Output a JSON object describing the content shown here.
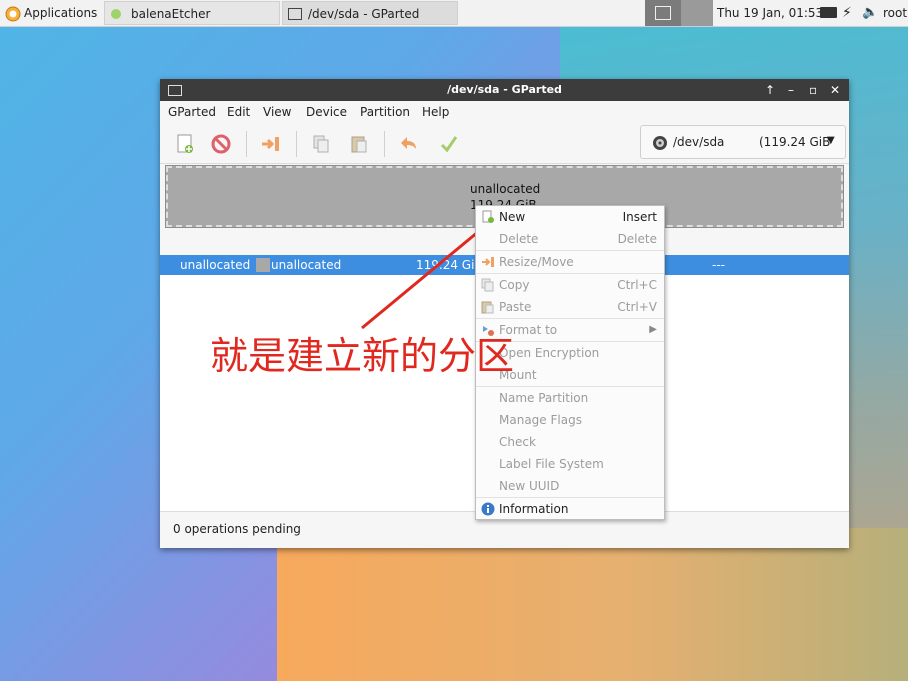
{
  "panel": {
    "applications_label": "Applications",
    "tasks": [
      {
        "label": "balenaEtcher"
      },
      {
        "label": "/dev/sda - GParted"
      }
    ],
    "clock": "Thu 19 Jan, 01:53",
    "user": "root"
  },
  "window": {
    "title": "/dev/sda - GParted",
    "menu": [
      "GParted",
      "Edit",
      "View",
      "Device",
      "Partition",
      "Help"
    ],
    "device_selector": {
      "device": "/dev/sda",
      "size": "(119.24 GiB"
    },
    "graph": {
      "label": "unallocated",
      "size": "119.24 GiB"
    },
    "partition_row": {
      "partition": "unallocated",
      "filesystem": "unallocated",
      "size": "119.24 GiB",
      "flags": "---"
    },
    "status": "0 operations pending"
  },
  "context_menu": {
    "items": [
      {
        "label": "New",
        "accel": "Insert",
        "enabled": true
      },
      {
        "label": "Delete",
        "accel": "Delete",
        "enabled": false
      },
      {
        "label": "Resize/Move",
        "accel": "",
        "enabled": false
      },
      {
        "label": "Copy",
        "accel": "Ctrl+C",
        "enabled": false
      },
      {
        "label": "Paste",
        "accel": "Ctrl+V",
        "enabled": false
      },
      {
        "label": "Format to",
        "accel": "",
        "enabled": false
      },
      {
        "label": "Open Encryption",
        "accel": "",
        "enabled": false
      },
      {
        "label": "Mount",
        "accel": "",
        "enabled": false
      },
      {
        "label": "Name Partition",
        "accel": "",
        "enabled": false
      },
      {
        "label": "Manage Flags",
        "accel": "",
        "enabled": false
      },
      {
        "label": "Check",
        "accel": "",
        "enabled": false
      },
      {
        "label": "Label File System",
        "accel": "",
        "enabled": false
      },
      {
        "label": "New UUID",
        "accel": "",
        "enabled": false
      },
      {
        "label": "Information",
        "accel": "",
        "enabled": true
      }
    ]
  },
  "annotation": {
    "text": "就是建立新的分区",
    "color": "#e0281f"
  },
  "colors": {
    "selection": "#3d8ee0",
    "titlebar": "#3c3c3c",
    "unallocated": "#a8a8a8"
  }
}
